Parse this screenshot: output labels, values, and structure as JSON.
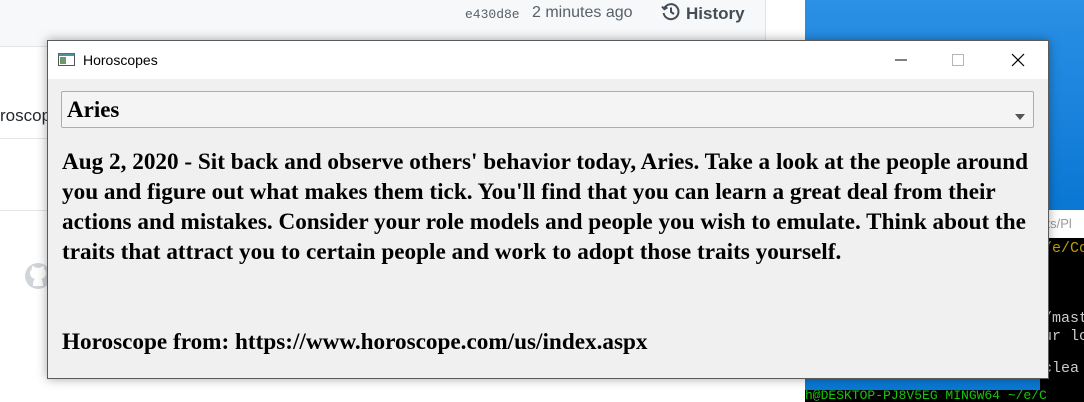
{
  "background_browser": {
    "commit_hash": "e430d8e",
    "commit_time": "2 minutes ago",
    "history_label": "History",
    "cut_text": "roscop"
  },
  "background_terminal": {
    "title_fragment": "cts/Pl",
    "lines": [
      "/e/Co",
      "",
      "/mast",
      "ur lo",
      "",
      " clea"
    ],
    "bottom_prompt": "h@DESKTOP-PJ8V5EG MINGW64 ~/e/C"
  },
  "window": {
    "title": "Horoscopes",
    "sign_select": {
      "value": "Aries"
    },
    "horoscope_text": "Aug 2, 2020 - Sit back and observe others' behavior today, Aries. Take a look at the people around you and figure out what makes them tick. You'll find that you can learn a great deal from their actions and mistakes. Consider your role models and people you wish to emulate. Think about the traits that attract you to certain people and work to adopt those traits yourself.",
    "source_text": "Horoscope from: https://www.horoscope.com/us/index.aspx"
  },
  "icons": {
    "history": "history-clock-icon",
    "app": "window-app-icon",
    "minimize": "minimize-icon",
    "maximize": "maximize-icon",
    "close": "close-icon",
    "dropdown": "chevron-down-icon",
    "github": "github-octocat-icon"
  },
  "colors": {
    "window_bg": "#f0f0f0",
    "titlebar_bg": "#ffffff",
    "desktop_blue": "#0a78d4",
    "text": "#000000"
  }
}
